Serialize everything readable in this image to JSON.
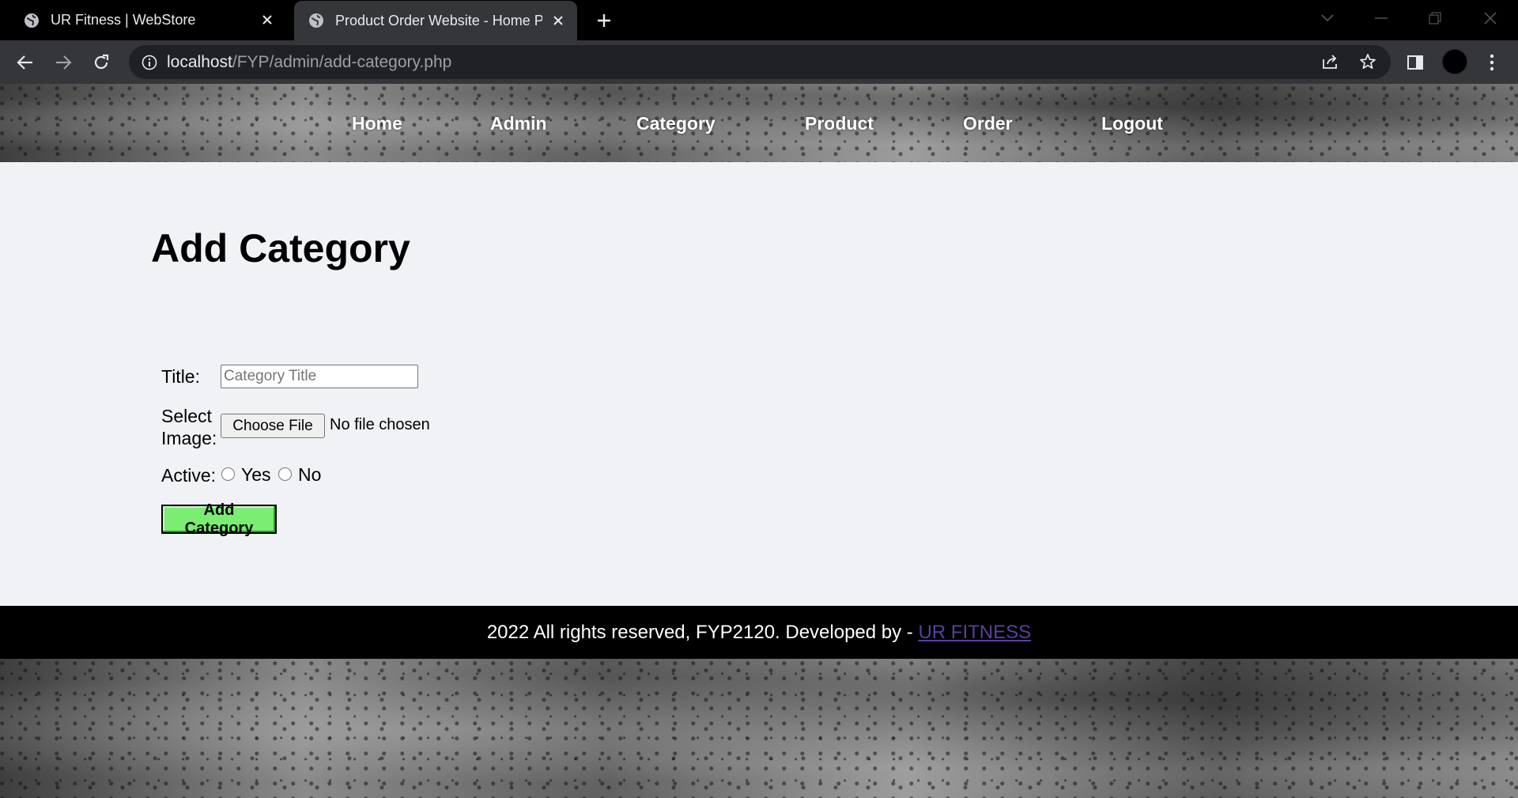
{
  "browser": {
    "tabs": [
      {
        "title": "UR Fitness | WebStore",
        "active": false
      },
      {
        "title": "Product Order Website - Home Page",
        "active": true
      }
    ],
    "url_host": "localhost",
    "url_path": "/FYP/admin/add-category.php"
  },
  "nav": {
    "items": [
      "Home",
      "Admin",
      "Category",
      "Product",
      "Order",
      "Logout"
    ]
  },
  "page": {
    "title": "Add Category"
  },
  "form": {
    "title_label": "Title:",
    "title_placeholder": "Category Title",
    "title_value": "",
    "image_label_line1": "Select",
    "image_label_line2": "Image:",
    "file_button": "Choose File",
    "file_status": "No file chosen",
    "active_label": "Active:",
    "active_options": [
      "Yes",
      "No"
    ],
    "active_selected": "",
    "submit_label": "Add Category"
  },
  "footer": {
    "text": "2022 All rights reserved, FYP2120. Developed by - ",
    "link_text": "UR FITNESS"
  },
  "colors": {
    "submit_bg": "#7bed72",
    "main_bg": "#f1f2f6",
    "footer_bg": "#000000",
    "footer_link": "#5a3fa0"
  }
}
